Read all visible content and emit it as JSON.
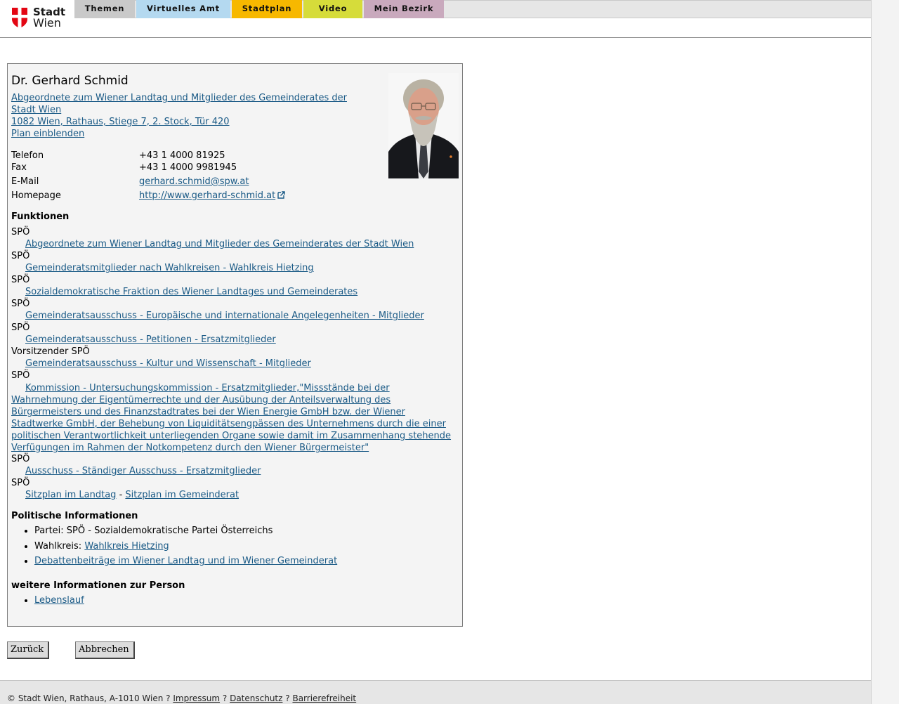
{
  "header": {
    "logo": {
      "line1": "Stadt",
      "line2": "Wien"
    },
    "nav": [
      {
        "label": "Themen",
        "color": "#c9c9c9",
        "width": 86
      },
      {
        "label": "Virtuelles Amt",
        "color": "#b4d9f0",
        "width": 134
      },
      {
        "label": "Stadtplan",
        "color": "#f7b800",
        "width": 100
      },
      {
        "label": "Video",
        "color": "#d6dc3a",
        "width": 84
      },
      {
        "label": "Mein Bezirk",
        "color": "#c9a9bd",
        "width": 114
      }
    ]
  },
  "person": {
    "name": "Dr. Gerhard Schmid",
    "role_line1": "Abgeordnete zum Wiener Landtag und Mitglieder des Gemeinderates der",
    "role_line2": "Stadt Wien ",
    "address": "1082 Wien, Rathaus, Stiege 7, 2. Stock, Tür 420",
    "plan_link": "Plan einblenden"
  },
  "contact": {
    "phone_label": "Telefon",
    "phone": "+43 1 4000 81925",
    "fax_label": "Fax",
    "fax": "+43 1 4000 9981945",
    "email_label": "E-Mail",
    "email": "gerhard.schmid@spw.at",
    "homepage_label": "Homepage",
    "homepage": "http://www.gerhard-schmid.at"
  },
  "funktionen": {
    "heading": "Funktionen",
    "items": [
      {
        "party": "SPÖ",
        "link": "Abgeordnete zum Wiener Landtag und Mitglieder des Gemeinderates der Stadt Wien"
      },
      {
        "party": "SPÖ",
        "link": "Gemeinderatsmitglieder nach Wahlkreisen - Wahlkreis Hietzing"
      },
      {
        "party": "SPÖ",
        "link": "Sozialdemokratische Fraktion des Wiener Landtages und Gemeinderates"
      },
      {
        "party": "SPÖ",
        "link": "Gemeinderatsausschuss - Europäische und internationale Angelegenheiten - Mitglieder"
      },
      {
        "party": "SPÖ",
        "link": "Gemeinderatsausschuss - Petitionen - Ersatzmitglieder"
      },
      {
        "party": "Vorsitzender SPÖ",
        "link": "Gemeinderatsausschuss - Kultur und Wissenschaft - Mitglieder"
      },
      {
        "party": "SPÖ",
        "link": "Kommission - Untersuchungskommission - Ersatzmitglieder,\"Missstände bei der Wahrnehmung der Eigentümerrechte und der Ausübung der Anteilsverwaltung des Bürgermeisters und des Finanzstadtrates bei der Wien Energie GmbH bzw. der Wiener Stadtwerke GmbH, der Behebung von Liquiditätsengpässen des Unternehmens durch die einer politischen Verantwortlichkeit unterliegenden Organe sowie damit im Zusammenhang stehende Verfügungen im Rahmen der Notkompetenz durch den Wiener Bürgermeister\""
      },
      {
        "party": "SPÖ",
        "link": "Ausschuss - Ständiger Ausschuss - Ersatzmitglieder"
      },
      {
        "party": "SPÖ"
      }
    ],
    "seat_landtag": "Sitzplan im Landtag",
    "seat_sep": "-",
    "seat_gemeinderat": "Sitzplan im Gemeinderat"
  },
  "politisch": {
    "heading": "Politische Informationen",
    "partei": "Partei: SPÖ - Sozialdemokratische Partei Österreichs",
    "wahlkreis_label": "Wahlkreis: ",
    "wahlkreis_link": "Wahlkreis Hietzing",
    "debatten": "Debattenbeiträge im Wiener Landtag und im Wiener Gemeinderat"
  },
  "weitere": {
    "heading": "weitere Informationen zur Person",
    "lebenslauf": "Lebenslauf"
  },
  "buttons": {
    "back": "Zurück",
    "cancel": "Abbrechen"
  },
  "footer": {
    "copyright": "© Stadt Wien, Rathaus, A-1010 Wien",
    "sep": "?",
    "impressum": "Impressum",
    "datenschutz": "Datenschutz",
    "barrierefreiheit": "Barrierefreiheit"
  }
}
